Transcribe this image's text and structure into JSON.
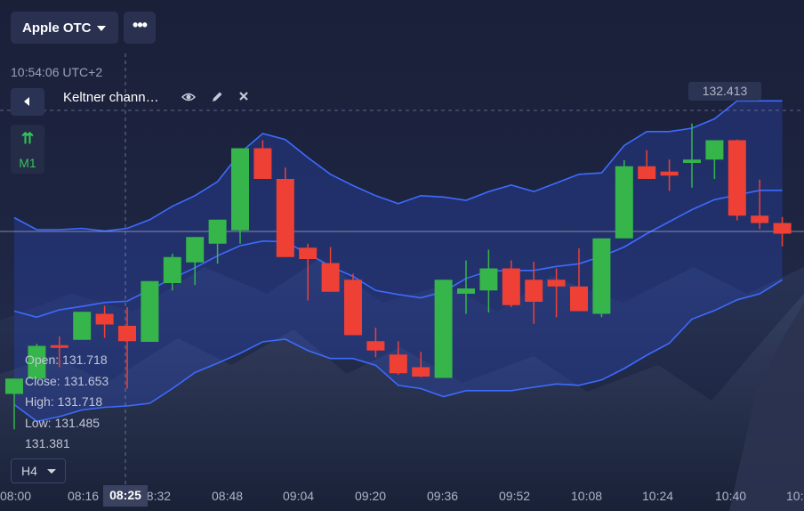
{
  "header": {
    "asset_label": "Apple OTC",
    "more_label": "•••"
  },
  "clock": "10:54:06 UTC+2",
  "indicator": {
    "name": "Keltner chann…",
    "icons": [
      "eye-icon",
      "pencil-icon",
      "close-icon"
    ]
  },
  "timeframe": {
    "arrow": "⇈",
    "label": "M1"
  },
  "price_label": "132.413",
  "ohlc": {
    "open": "Open: 131.718",
    "close": "Close: 131.653",
    "high": "High: 131.718",
    "low": "Low: 131.485",
    "extra": "131.381"
  },
  "period_button": "H4",
  "x_axis": {
    "labels": [
      "08:00",
      "08:16",
      "08:32",
      "08:48",
      "09:04",
      "09:20",
      "09:36",
      "09:52",
      "10:08",
      "10:24",
      "10:40",
      "10:5"
    ],
    "marker": "08:25"
  },
  "colors": {
    "up": "#35b54a",
    "down": "#ee4035",
    "band": "#3d6bff"
  },
  "chart_data": {
    "type": "candlestick",
    "candles": [
      {
        "o": 130.8,
        "h": 131.0,
        "l": 130.27,
        "c": 131.03
      },
      {
        "o": 131.03,
        "h": 131.55,
        "l": 131.02,
        "c": 131.52
      },
      {
        "o": 131.53,
        "h": 131.66,
        "l": 131.2,
        "c": 131.49
      },
      {
        "o": 131.61,
        "h": 132.03,
        "l": 131.61,
        "c": 132.03
      },
      {
        "o": 132.0,
        "h": 132.12,
        "l": 131.64,
        "c": 131.84
      },
      {
        "o": 131.82,
        "h": 132.1,
        "l": 130.88,
        "c": 131.59
      },
      {
        "o": 131.58,
        "h": 132.49,
        "l": 131.58,
        "c": 132.49
      },
      {
        "o": 132.46,
        "h": 132.9,
        "l": 132.35,
        "c": 132.85
      },
      {
        "o": 132.77,
        "h": 133.15,
        "l": 132.43,
        "c": 133.15
      },
      {
        "o": 133.05,
        "h": 133.35,
        "l": 132.75,
        "c": 133.41
      },
      {
        "o": 133.25,
        "h": 134.11,
        "l": 133.05,
        "c": 134.48
      },
      {
        "o": 134.48,
        "h": 134.6,
        "l": 134.02,
        "c": 134.02
      },
      {
        "o": 134.02,
        "h": 134.19,
        "l": 132.95,
        "c": 132.85
      },
      {
        "o": 132.99,
        "h": 133.05,
        "l": 132.2,
        "c": 132.82
      },
      {
        "o": 132.76,
        "h": 133.0,
        "l": 132.35,
        "c": 132.33
      },
      {
        "o": 132.51,
        "h": 132.6,
        "l": 131.96,
        "c": 131.68
      },
      {
        "o": 131.59,
        "h": 131.79,
        "l": 131.35,
        "c": 131.45
      },
      {
        "o": 131.39,
        "h": 131.59,
        "l": 131.09,
        "c": 131.11
      },
      {
        "o": 131.2,
        "h": 131.43,
        "l": 131.05,
        "c": 131.06
      },
      {
        "o": 131.04,
        "h": 132.51,
        "l": 131.04,
        "c": 132.51
      },
      {
        "o": 132.3,
        "h": 132.8,
        "l": 132.0,
        "c": 132.38
      },
      {
        "o": 132.35,
        "h": 132.96,
        "l": 132.02,
        "c": 132.68
      },
      {
        "o": 132.68,
        "h": 132.8,
        "l": 132.1,
        "c": 132.13
      },
      {
        "o": 132.51,
        "h": 132.78,
        "l": 131.85,
        "c": 132.18
      },
      {
        "o": 132.51,
        "h": 132.68,
        "l": 131.95,
        "c": 132.41
      },
      {
        "o": 132.41,
        "h": 132.98,
        "l": 132.3,
        "c": 132.04
      },
      {
        "o": 132.0,
        "h": 133.13,
        "l": 131.95,
        "c": 133.13
      },
      {
        "o": 133.13,
        "h": 134.3,
        "l": 133.2,
        "c": 134.21
      },
      {
        "o": 134.21,
        "h": 134.45,
        "l": 134.12,
        "c": 134.02
      },
      {
        "o": 134.13,
        "h": 134.31,
        "l": 133.84,
        "c": 134.07
      },
      {
        "o": 134.26,
        "h": 134.85,
        "l": 133.89,
        "c": 134.31
      },
      {
        "o": 134.31,
        "h": 134.6,
        "l": 134.02,
        "c": 134.6
      },
      {
        "o": 134.6,
        "h": 134.61,
        "l": 133.4,
        "c": 133.47
      },
      {
        "o": 133.47,
        "h": 134.01,
        "l": 133.27,
        "c": 133.36
      },
      {
        "o": 133.36,
        "h": 133.45,
        "l": 133.01,
        "c": 133.2
      }
    ],
    "bands": {
      "upper": [
        133.44,
        133.26,
        133.26,
        133.28,
        133.24,
        133.28,
        133.41,
        133.61,
        133.77,
        133.98,
        134.41,
        134.7,
        134.61,
        134.34,
        134.09,
        133.92,
        133.77,
        133.65,
        133.77,
        133.75,
        133.7,
        133.83,
        133.93,
        133.83,
        133.96,
        134.09,
        134.11,
        134.52,
        134.73,
        134.73,
        134.78,
        134.92,
        135.19,
        135.19,
        135.19
      ],
      "middle": [
        132.04,
        131.95,
        132.06,
        132.11,
        132.17,
        132.19,
        132.36,
        132.53,
        132.69,
        132.87,
        133.02,
        133.09,
        133.08,
        132.9,
        132.71,
        132.56,
        132.35,
        132.29,
        132.24,
        132.33,
        132.53,
        132.64,
        132.65,
        132.65,
        132.71,
        132.75,
        132.86,
        133.0,
        133.2,
        133.38,
        133.56,
        133.71,
        133.78,
        133.85,
        133.85
      ],
      "lower": [
        130.64,
        130.39,
        130.46,
        130.56,
        130.6,
        130.62,
        130.66,
        130.88,
        131.12,
        131.26,
        131.41,
        131.58,
        131.62,
        131.45,
        131.33,
        131.33,
        131.23,
        130.93,
        130.88,
        130.76,
        130.85,
        130.85,
        130.85,
        130.9,
        130.95,
        130.93,
        131.01,
        131.18,
        131.38,
        131.56,
        131.92,
        132.05,
        132.21,
        132.3,
        132.51
      ]
    },
    "current_price": 132.413,
    "x_labels": [
      "08:00",
      "08:16",
      "08:32",
      "08:48",
      "09:04",
      "09:20",
      "09:36",
      "09:52",
      "10:08",
      "10:24",
      "10:40"
    ]
  }
}
